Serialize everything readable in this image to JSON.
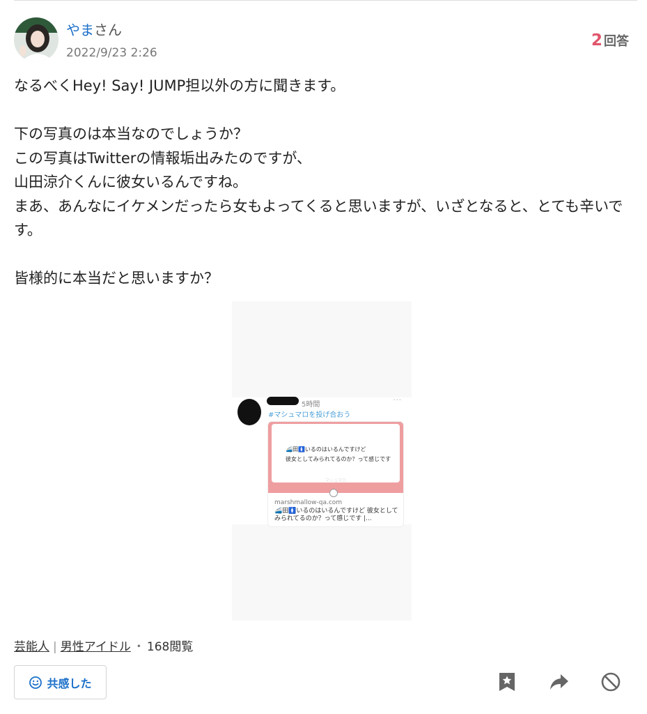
{
  "user": {
    "name": "やま",
    "suffix": "さん",
    "posted_at": "2022/9/23 2:26"
  },
  "answers": {
    "count": "2",
    "label": "回答"
  },
  "question": {
    "lines": [
      "なるべくHey! Say! JUMP担以外の方に聞きます。",
      "",
      "下の写真のは本当なのでしょうか？",
      "この写真はTwitterの情報垢出みたのですが、",
      "山田涼介くんに彼女いるんですね。",
      "まあ、あんなにイケメンだったら女もよってくると思いますが、いざとなると、とても辛いです。",
      "",
      "皆様的に本当だと思いますか？"
    ]
  },
  "image": {
    "time": "5時間",
    "dots": "···",
    "hashtag": "#マシュマロを投げ合おう",
    "message_line1": "🚄田🚺いるのはいるんですけど",
    "message_line2": "彼女としてみられてるのか？って感じです",
    "brand": "マシュマロ",
    "domain": "marshmallow-qa.com",
    "excerpt": "🚄田🚺いるのはいるんですけど 彼女としてみられてるのか？って感じです |..."
  },
  "tags": {
    "category1": "芸能人",
    "separator": "|",
    "category2": "男性アイドル",
    "dot": "・",
    "views": "168閲覧"
  },
  "buttons": {
    "empathy": "共感した"
  },
  "colors": {
    "link": "#1a6fc9",
    "answer_count": "#e0556b",
    "icon": "#666666"
  }
}
